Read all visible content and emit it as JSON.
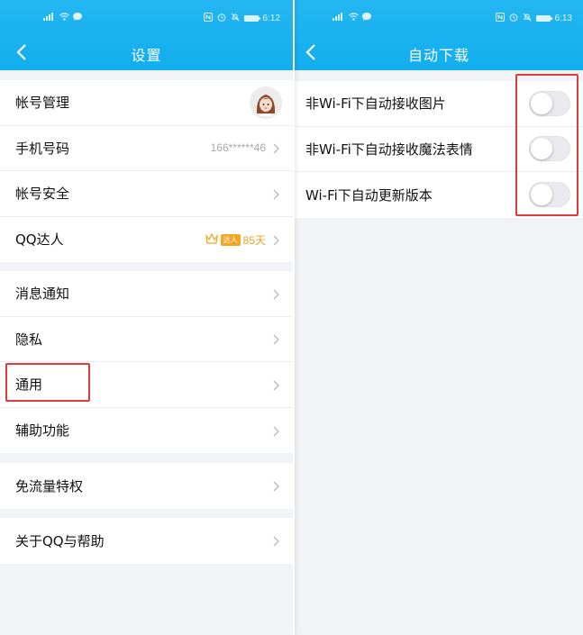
{
  "left": {
    "status_time": "6:12",
    "title": "设置",
    "groups": [
      {
        "items": [
          {
            "label": "帐号管理"
          },
          {
            "label": "手机号码",
            "value": "166******46"
          },
          {
            "label": "帐号安全"
          },
          {
            "label": "QQ达人",
            "badge_text": "达人",
            "days": "85天"
          }
        ]
      },
      {
        "items": [
          {
            "label": "消息通知"
          },
          {
            "label": "隐私"
          },
          {
            "label": "通用"
          },
          {
            "label": "辅助功能"
          }
        ]
      },
      {
        "items": [
          {
            "label": "免流量特权"
          }
        ]
      },
      {
        "items": [
          {
            "label": "关于QQ与帮助"
          }
        ]
      }
    ]
  },
  "right": {
    "status_time": "6:13",
    "title": "自动下载",
    "items": [
      {
        "label": "非Wi-Fi下自动接收图片",
        "enabled": false
      },
      {
        "label": "非Wi-Fi下自动接收魔法表情",
        "enabled": false
      },
      {
        "label": "Wi-Fi下自动更新版本",
        "enabled": false
      }
    ]
  },
  "colors": {
    "header": "#12aeee",
    "highlight_box": "#e03a3a",
    "badge": "#f5a623"
  }
}
